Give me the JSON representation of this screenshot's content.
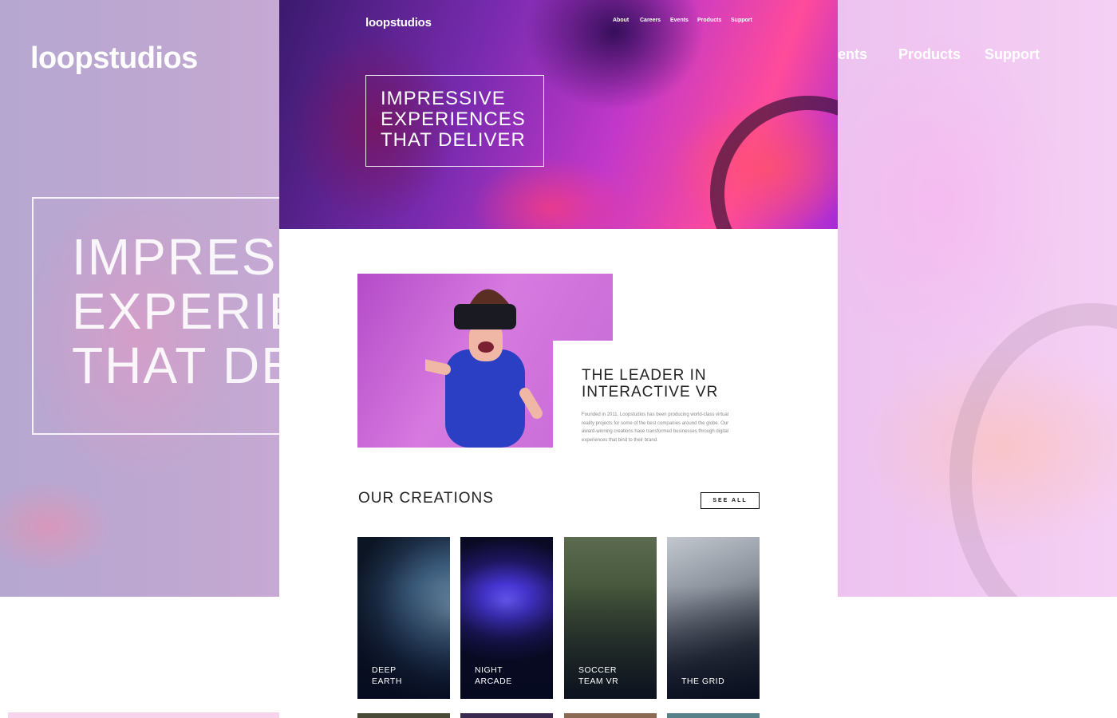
{
  "brand": {
    "name": "loopstudios"
  },
  "nav": {
    "items": [
      "About",
      "Careers",
      "Events",
      "Products",
      "Support"
    ]
  },
  "background": {
    "nav_visible": [
      "Events",
      "Products",
      "Support"
    ],
    "nav_first_partial": "vents",
    "headline_lines": [
      "IMPRESS",
      "EXPERIE",
      "THAT DE"
    ]
  },
  "hero": {
    "title_lines": [
      "IMPRESSIVE",
      "EXPERIENCES",
      "THAT DELIVER"
    ]
  },
  "about": {
    "title_lines": [
      "THE LEADER IN",
      "INTERACTIVE VR"
    ],
    "body": "Founded in 2011, Loopstudios has been producing world-class virtual reality projects for some of the best companies around the globe. Our award-winning creations have transformed businesses through digital experiences that bind to their brand."
  },
  "creations": {
    "title": "OUR CREATIONS",
    "see_all": "SEE ALL",
    "items": [
      {
        "lines": [
          "DEEP",
          "EARTH"
        ]
      },
      {
        "lines": [
          "NIGHT",
          "ARCADE"
        ]
      },
      {
        "lines": [
          "SOCCER",
          "TEAM VR"
        ]
      },
      {
        "lines": [
          "THE GRID"
        ]
      }
    ]
  },
  "colors": {
    "accent_pink": "#ff4b9a",
    "accent_purple": "#7a2bb0",
    "text_dark": "#222222"
  }
}
